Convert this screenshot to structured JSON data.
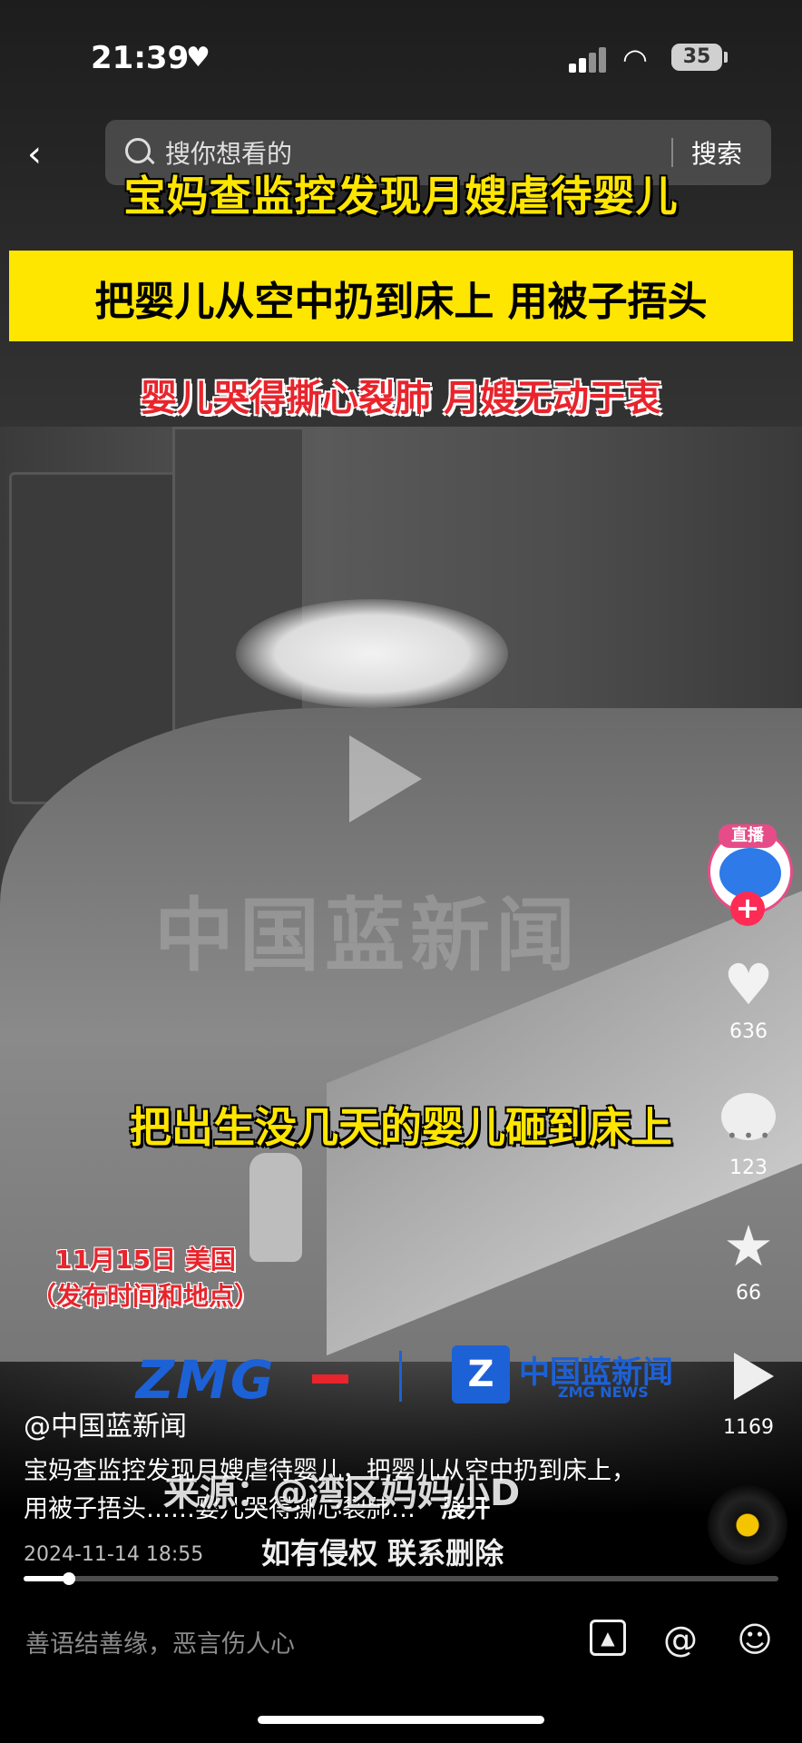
{
  "status_bar": {
    "time": "21:39",
    "battery": "35"
  },
  "search": {
    "placeholder": "搜你想看的",
    "button": "搜索"
  },
  "headlines": {
    "h1": "宝妈查监控发现月嫂虐待婴儿",
    "h2": "把婴儿从空中扔到床上 用被子捂头",
    "h3": "婴儿哭得撕心裂肺 月嫂无动于衷"
  },
  "video": {
    "watermark": "中国蓝新闻",
    "caption": "把出生没几天的婴儿砸到床上",
    "date_note_line1": "11月15日 美国",
    "date_note_line2": "（发布时间和地点）",
    "logo_zmg": "ZMG",
    "logo_news": "中国蓝新闻",
    "logo_news_sub": "ZMG NEWS",
    "source_watermark": "来源：@湾区妈妈小D",
    "rights_note": "如有侵权 联系删除",
    "progress": 0.06
  },
  "side": {
    "live_label": "直播",
    "follow": "+",
    "likes": "636",
    "comments": "123",
    "favorites": "66",
    "shares": "1169"
  },
  "post": {
    "author": "@中国蓝新闻",
    "description": "宝妈查监控发现月嫂虐待婴儿，把婴儿从空中扔到床上，用被子捂头……婴儿哭得撕心裂肺…",
    "expand": "展开",
    "timestamp": "2024-11-14 18:55"
  },
  "comment_bar": {
    "placeholder": "善语结善缘，恶言伤人心"
  },
  "icons": [
    "back-icon",
    "search-icon",
    "play-icon",
    "heart-icon",
    "comment-icon",
    "star-icon",
    "share-icon",
    "image-icon",
    "at-icon",
    "emoji-icon"
  ]
}
